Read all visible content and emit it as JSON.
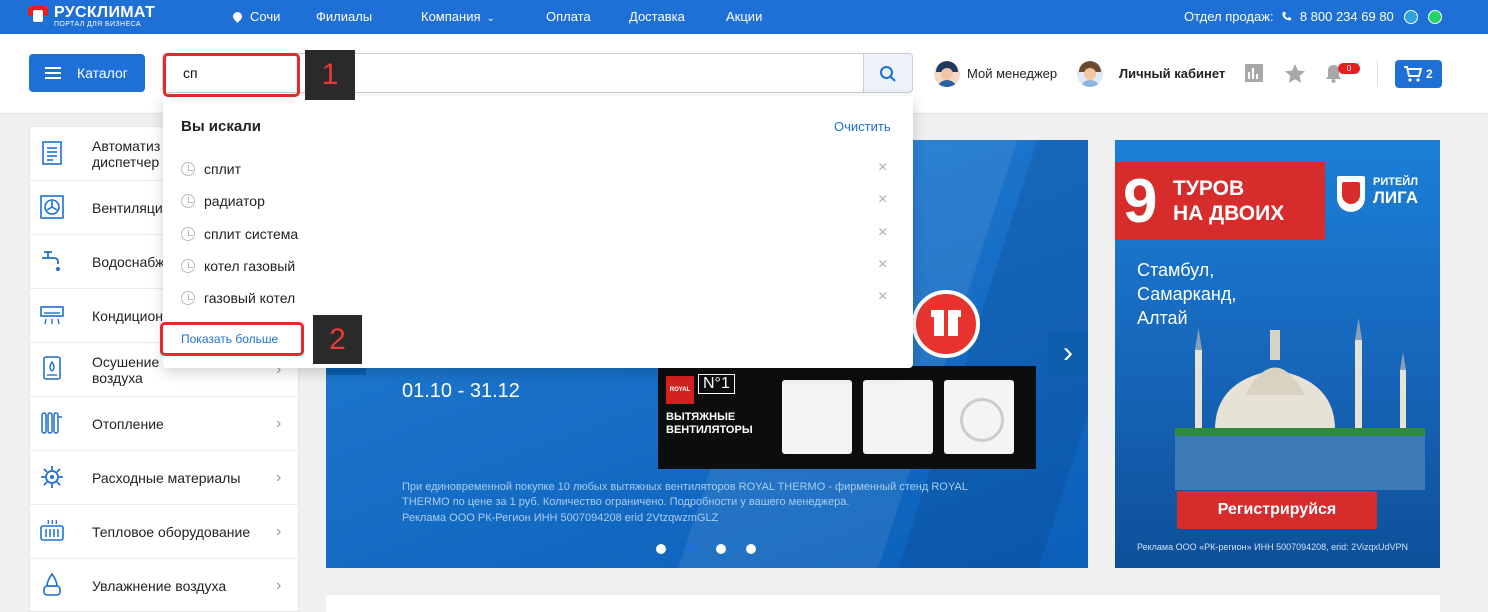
{
  "topbar": {
    "logo_name": "РУСКЛИМАТ",
    "logo_sub": "ПОРТАЛ ДЛЯ БИЗНЕСА",
    "city": "Сочи",
    "nav": [
      "Филиалы",
      "Компания",
      "Оплата",
      "Доставка",
      "Акции"
    ],
    "sales_label": "Отдел продаж:",
    "phone": "8 800 234 69 80"
  },
  "header": {
    "catalog_label": "Каталог",
    "search_value": "сп",
    "manager_label": "Мой менеджер",
    "cabinet_label": "Личный кабинет",
    "notifications_count": "0",
    "cart_count": "2"
  },
  "sidebar": {
    "items": [
      {
        "label": "Автоматиз\nдиспетчер",
        "icon": "automation-icon"
      },
      {
        "label": "Вентиляци",
        "icon": "ventilation-icon"
      },
      {
        "label": "Водоснабж",
        "icon": "water-supply-icon"
      },
      {
        "label": "Кондицион",
        "icon": "air-conditioner-icon"
      },
      {
        "label": "Осушение\nвоздуха",
        "icon": "dehumidifier-icon"
      },
      {
        "label": "Отопление",
        "icon": "radiator-icon"
      },
      {
        "label": "Расходные материалы",
        "icon": "gear-icon"
      },
      {
        "label": "Тепловое оборудование",
        "icon": "heater-icon"
      },
      {
        "label": "Увлажнение воздуха",
        "icon": "humidifier-icon"
      }
    ]
  },
  "dropdown": {
    "title": "Вы искали",
    "clear_label": "Очистить",
    "history": [
      "сплит",
      "радиатор",
      "сплит система",
      "котел газовый",
      "газовый котел"
    ],
    "show_more": "Показать больше"
  },
  "banner": {
    "date": "01.10 - 31.12",
    "brand": "ROYAL",
    "no1": "N°1",
    "product_title": "ВЫТЯЖНЫЕ\nВЕНТИЛЯТОРЫ",
    "disclaimer": "При единовременной покупке 10 любых вытяжных вентиляторов ROYAL THERMO - фирменный стенд ROYAL THERMO по цене за 1 руб. Количество ограничено. Подробности у вашего менеджера.",
    "ad_note": "Реклама ООО РК-Регион ИНН 5007094208 erid 2VtzqwzmGLZ",
    "slide_count": 4,
    "active_slide": 1
  },
  "promo": {
    "number": "9",
    "title": "ТУРОВ\nНА ДВОИХ",
    "liga_small": "РИТЕЙЛ",
    "liga_big": "ЛИГА",
    "cities": "Стамбул,\nСамарканд,\nАлтай",
    "register": "Регистрируйся",
    "ad_note": "Реклама ООО «РК-регион» ИНН 5007094208, erid: 2VizqxUdVPN"
  },
  "annotations": [
    "1",
    "2"
  ],
  "colors": {
    "brand_blue": "#1e6fd6",
    "accent_red": "#e32a2a"
  }
}
